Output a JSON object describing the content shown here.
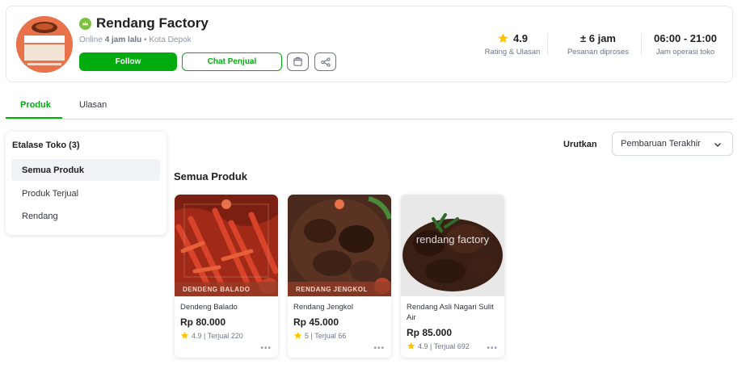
{
  "shop": {
    "name": "Rendang Factory",
    "status_prefix": "Online",
    "last_online": "4 jam lalu",
    "location": "• Kota Depok",
    "follow_label": "Follow",
    "chat_label": "Chat Penjual",
    "avatar_text": "Rendang Factory"
  },
  "stats": [
    {
      "value": "4.9",
      "label": "Rating & Ulasan"
    },
    {
      "value": "± 6 jam",
      "label": "Pesanan diproses"
    },
    {
      "value": "06:00 - 21:00",
      "label": "Jam operasi toko"
    }
  ],
  "tabs": [
    {
      "label": "Produk",
      "active": true
    },
    {
      "label": "Ulasan",
      "active": false
    }
  ],
  "etalase": {
    "title": "Etalase Toko (3)",
    "items": [
      "Semua Produk",
      "Produk Terjual",
      "Rendang"
    ]
  },
  "sort": {
    "label": "Urutkan",
    "selected": "Pembaruan Terakhir"
  },
  "section_title": "Semua Produk",
  "products": [
    {
      "name": "Dendeng Balado",
      "price": "Rp 80.000",
      "rating": "4.9",
      "sold": "| Terjual 220",
      "caption": "DENDENG BALADO"
    },
    {
      "name": "Rendang Jengkol",
      "price": "Rp 45.000",
      "rating": "5",
      "sold": "| Terjual 66",
      "caption": "RENDANG JENGKOL"
    },
    {
      "name": "Rendang Asli Nagari Sulit Air",
      "price": "Rp 85.000",
      "rating": "4.9",
      "sold": "| Terjual 692",
      "watermark": "rendang factory"
    }
  ],
  "colors": {
    "brand_green": "#03ac0e",
    "star": "#ffc400"
  }
}
